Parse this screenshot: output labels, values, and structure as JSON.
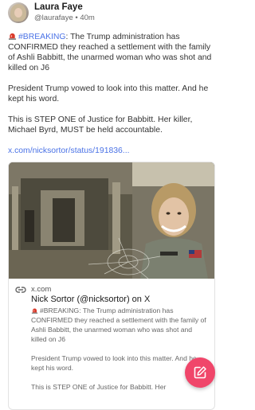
{
  "post": {
    "author_name": "Laura Faye",
    "author_handle": "@laurafaye",
    "separator": "•",
    "time_ago": "40m",
    "paragraph1_tag": "#BREAKING",
    "paragraph1_rest": ": The Trump administration has CONFIRMED they reached a settlement with the family of Ashli Babbitt, the unarmed woman who was shot and killed on J6",
    "paragraph2": "President Trump vowed to look into this matter. And he kept his word.",
    "paragraph3": "This is STEP ONE of Justice for Babbitt. Her killer, Michael Byrd, MUST be held accountable.",
    "link_text": "x.com/nicksortor/status/191836..."
  },
  "link_card": {
    "domain": "x.com",
    "title": "Nick Sortor (@nicksortor) on X",
    "desc_p1": "#BREAKING: The Trump administration has CONFIRMED they reached a settlement with the family of Ashli Babbitt, the unarmed woman who was shot and killed on J6",
    "desc_p2": "President Trump vowed to look into this matter. And he kept his word.",
    "desc_p3": "This is STEP ONE of Justice for Babbitt. Her"
  },
  "icons": {
    "siren": "police-siren-icon",
    "link": "link-icon",
    "compose": "compose-pencil-icon"
  },
  "colors": {
    "accent_link": "#4a72e6",
    "fab": "#f0466a",
    "siren_red": "#d93a2b"
  }
}
